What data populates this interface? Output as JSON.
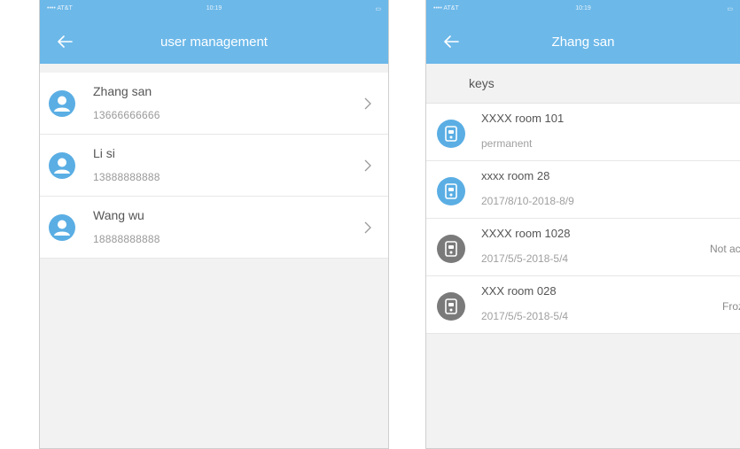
{
  "colors": {
    "header": "#6cb8e9",
    "active_icon": "#5aaee4",
    "inactive_icon": "#7a7a7a"
  },
  "screen1": {
    "status": {
      "carrier": "•••• AT&T",
      "time": "10:19",
      "battery": "▭"
    },
    "title": "user management",
    "users": [
      {
        "name": "Zhang san",
        "phone": "13666666666"
      },
      {
        "name": "Li si",
        "phone": "13888888888"
      },
      {
        "name": "Wang wu",
        "phone": "18888888888"
      }
    ]
  },
  "screen2": {
    "status": {
      "carrier": "•••• AT&T",
      "time": "10:19",
      "battery": "▭"
    },
    "title": "Zhang san",
    "section_label": "keys",
    "keys": [
      {
        "name": "XXXX room 101",
        "date": "permanent",
        "status": "",
        "active": true
      },
      {
        "name": "xxxx room 28",
        "date": "2017/8/10-2018-8/9",
        "status": "",
        "active": true
      },
      {
        "name": "XXXX room 1028",
        "date": "2017/5/5-2018-5/4",
        "status": "Not act",
        "active": false
      },
      {
        "name": "XXX room 028",
        "date": "2017/5/5-2018-5/4",
        "status": "Froz",
        "active": false
      }
    ]
  }
}
